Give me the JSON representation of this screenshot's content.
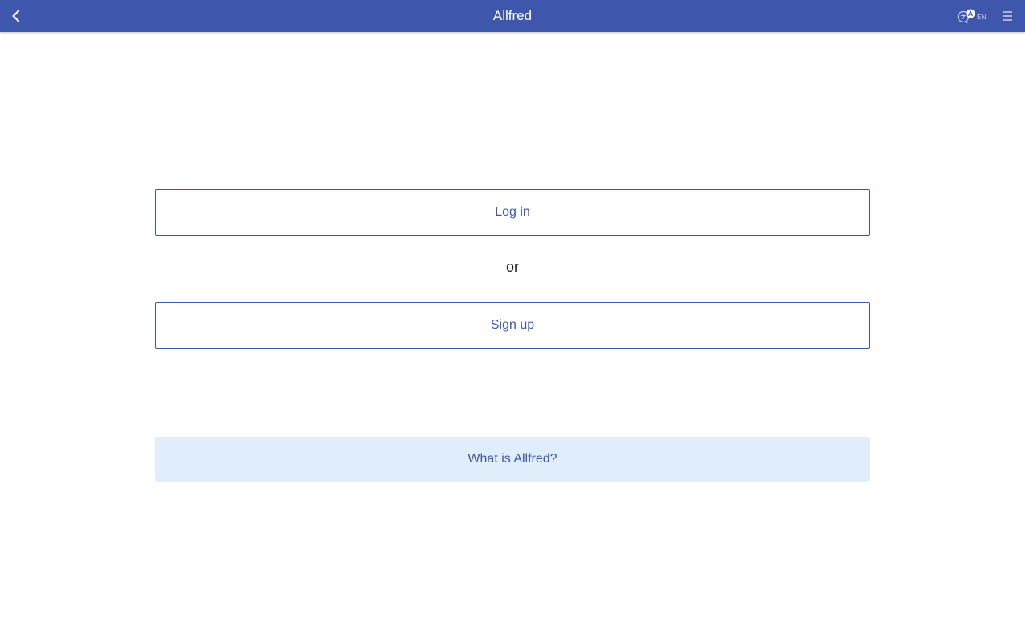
{
  "header": {
    "title": "Allfred",
    "back_icon": "chevron-left-icon",
    "language_icon": "translate-icon",
    "language_code": "EN",
    "menu_icon": "hamburger-menu-icon",
    "bar_color": "#3f56ad"
  },
  "auth": {
    "login_label": "Log in",
    "separator": "or",
    "signup_label": "Sign up"
  },
  "info": {
    "label": "What is Allfred?",
    "background_color": "#e0eefc"
  },
  "accent_color": "#3f56ad"
}
